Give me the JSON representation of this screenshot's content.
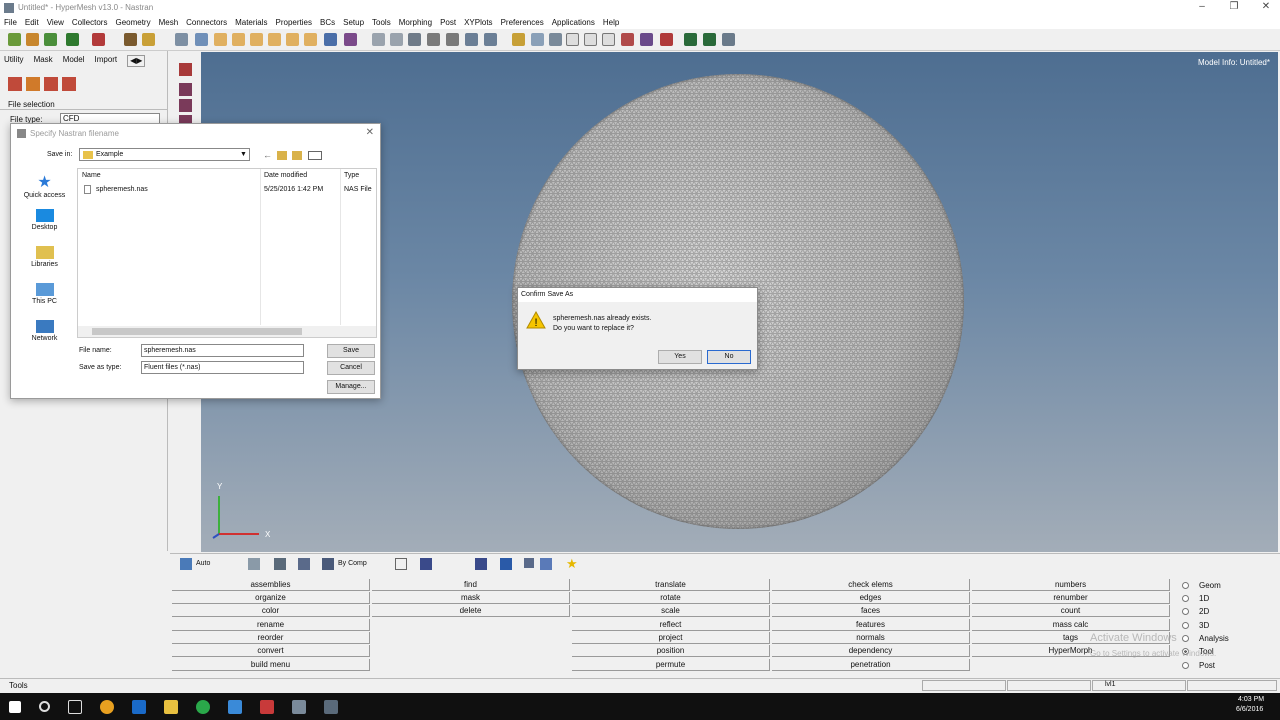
{
  "window": {
    "title": "Untitled* - HyperMesh v13.0 - Nastran"
  },
  "menu": [
    "File",
    "Edit",
    "View",
    "Collectors",
    "Geometry",
    "Mesh",
    "Connectors",
    "Materials",
    "Properties",
    "BCs",
    "Setup",
    "Tools",
    "Morphing",
    "Post",
    "XYPlots",
    "Preferences",
    "Applications",
    "Help"
  ],
  "left": {
    "tabs": [
      "Utility",
      "Mask",
      "Model",
      "Import"
    ],
    "file_selection": "File selection",
    "file_type_label": "File type:",
    "file_type_value": "CFD"
  },
  "viewport": {
    "model_info": "Model Info: Untitled*",
    "axis_y": "Y",
    "axis_x": "X"
  },
  "file_dialog": {
    "title": "Specify Nastran filename",
    "save_in_label": "Save in:",
    "save_in_value": "Example",
    "places": [
      "Quick access",
      "Desktop",
      "Libraries",
      "This PC",
      "Network"
    ],
    "columns": [
      "Name",
      "Date modified",
      "Type"
    ],
    "rows": [
      {
        "name": "spheremesh.nas",
        "date": "5/25/2016 1:42 PM",
        "type": "NAS File"
      }
    ],
    "file_name_label": "File name:",
    "file_name_value": "spheremesh.nas",
    "save_as_type_label": "Save as type:",
    "save_as_type_value": "Fluent files (*.nas)",
    "save": "Save",
    "cancel": "Cancel",
    "manage": "Manage..."
  },
  "confirm": {
    "title": "Confirm Save As",
    "line1": "spheremesh.nas already exists.",
    "line2": "Do you want to replace it?",
    "yes": "Yes",
    "no": "No"
  },
  "bottom_toolbar": {
    "auto": "Auto",
    "by_comp": "By Comp"
  },
  "panel_grid": [
    [
      "assemblies",
      "organize",
      "color",
      "rename",
      "reorder",
      "convert",
      "build menu"
    ],
    [
      "find",
      "mask",
      "delete",
      "",
      "",
      "",
      ""
    ],
    [
      "translate",
      "rotate",
      "scale",
      "reflect",
      "project",
      "position",
      "permute"
    ],
    [
      "check elems",
      "edges",
      "faces",
      "features",
      "normals",
      "dependency",
      "penetration"
    ],
    [
      "numbers",
      "renumber",
      "count",
      "mass calc",
      "tags",
      "HyperMorph",
      ""
    ]
  ],
  "radios": [
    "Geom",
    "1D",
    "2D",
    "3D",
    "Analysis",
    "Tool",
    "Post"
  ],
  "status": {
    "left": "Tools",
    "right": "lvl1"
  },
  "activate": {
    "line1": "Activate Windows",
    "line2": "Go to Settings to activate Windows."
  },
  "clock": {
    "time": "4:03 PM",
    "date": "6/6/2016"
  }
}
